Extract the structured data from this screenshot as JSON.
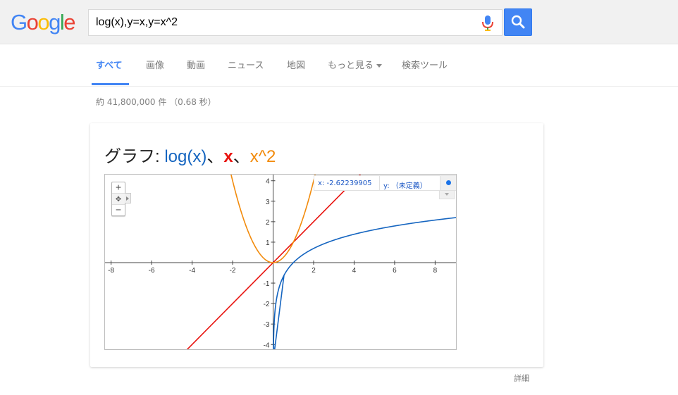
{
  "logo": {
    "letters": [
      "G",
      "o",
      "o",
      "g",
      "l",
      "e"
    ],
    "colors": [
      "#4285f4",
      "#ea4335",
      "#fbbc05",
      "#4285f4",
      "#34a853",
      "#ea4335"
    ]
  },
  "search": {
    "query": "log(x),y=x,y=x^2"
  },
  "tabs": [
    {
      "label": "すべて",
      "active": true
    },
    {
      "label": "画像"
    },
    {
      "label": "動画"
    },
    {
      "label": "ニュース"
    },
    {
      "label": "地図"
    },
    {
      "label": "もっと見る"
    },
    {
      "label": "検索ツール"
    }
  ],
  "stats": "約 41,800,000 件 （0.68 秒）",
  "card": {
    "title_prefix": "グラフ: ",
    "functions": [
      {
        "label": "log(x)",
        "color": "#1565c0"
      },
      {
        "label": "x",
        "color": "#e8130f"
      },
      {
        "label": "x^2",
        "color": "#f28b0c"
      }
    ],
    "separator": "、",
    "coords": {
      "x_text": "x: -2.62239905",
      "y_text": "y: （未定義）"
    },
    "zoom": {
      "in": "+",
      "pan": "✥",
      "out": "−"
    }
  },
  "details": "詳細",
  "chart_data": {
    "type": "line",
    "series": [
      {
        "name": "log(x)",
        "color": "#1565c0",
        "fn": "log"
      },
      {
        "name": "x",
        "color": "#e8130f",
        "fn": "identity"
      },
      {
        "name": "x^2",
        "color": "#f28b0c",
        "fn": "square"
      }
    ],
    "xlim": [
      -8.3,
      9.1
    ],
    "ylim": [
      -4.3,
      4.3
    ],
    "x_ticks": [
      -8,
      -6,
      -4,
      -2,
      2,
      4,
      6,
      8
    ],
    "y_ticks": [
      -4,
      -3,
      -2,
      -1,
      1,
      2,
      3,
      4
    ],
    "grid": false
  }
}
